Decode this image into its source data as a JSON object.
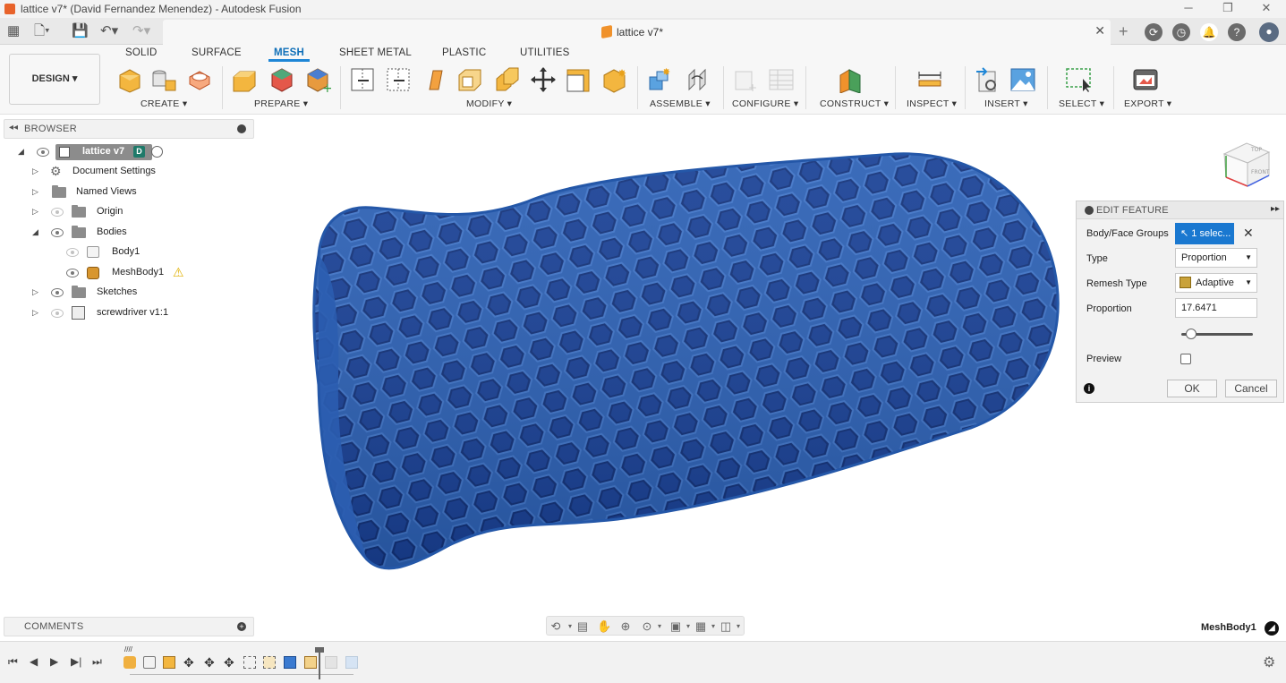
{
  "window": {
    "title": "lattice v7* (David Fernandez Menendez) - Autodesk Fusion",
    "minimize": "─",
    "maximize": "❐",
    "close": "✕"
  },
  "document_tab": {
    "name": "lattice v7*",
    "close": "✕"
  },
  "ribbon": {
    "workspace_button": "DESIGN ▾",
    "tabs": [
      "SOLID",
      "SURFACE",
      "MESH",
      "SHEET METAL",
      "PLASTIC",
      "UTILITIES"
    ],
    "active_tab": "MESH",
    "groups": [
      "CREATE ▾",
      "PREPARE ▾",
      "MODIFY ▾",
      "ASSEMBLE ▾",
      "CONFIGURE ▾",
      "CONSTRUCT ▾",
      "INSPECT ▾",
      "INSERT ▾",
      "SELECT ▾",
      "EXPORT ▾"
    ]
  },
  "browser": {
    "title": "BROWSER",
    "tree": [
      {
        "label": "lattice v7",
        "level": 0,
        "expanded": true
      },
      {
        "label": "Document Settings",
        "level": 1
      },
      {
        "label": "Named Views",
        "level": 1
      },
      {
        "label": "Origin",
        "level": 1
      },
      {
        "label": "Bodies",
        "level": 1,
        "expanded": true
      },
      {
        "label": "Body1",
        "level": 2
      },
      {
        "label": "MeshBody1",
        "level": 2,
        "warning": true
      },
      {
        "label": "Sketches",
        "level": 1
      },
      {
        "label": "screwdriver v1:1",
        "level": 1
      }
    ]
  },
  "comments": {
    "title": "COMMENTS"
  },
  "edit_feature": {
    "title": "EDIT FEATURE",
    "body_face_groups_label": "Body/Face Groups",
    "body_face_groups_value": "1 selec...",
    "type_label": "Type",
    "type_value": "Proportion",
    "remesh_type_label": "Remesh Type",
    "remesh_type_value": "Adaptive",
    "proportion_label": "Proportion",
    "proportion_value": "17.6471",
    "proportion_slider_level": 0.14,
    "preview_label": "Preview",
    "preview_checked": false,
    "ok": "OK",
    "cancel": "Cancel"
  },
  "viewcube": {
    "top": "TOP",
    "front": "FRONT"
  },
  "status": {
    "selection": "MeshBody1"
  },
  "colors": {
    "mesh_blue": "#2457a8",
    "accent": "#1e86d6",
    "select_blue": "#1a78d0"
  }
}
